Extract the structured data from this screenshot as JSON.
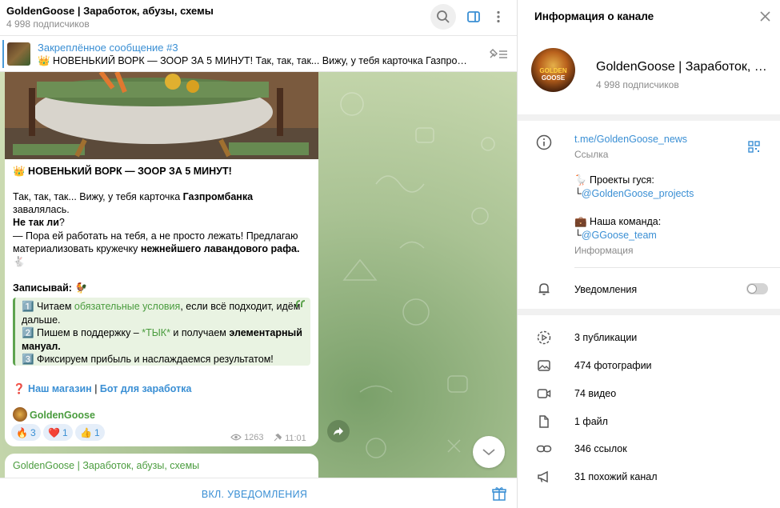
{
  "header": {
    "title": "GoldenGoose | Заработок, абузы, схемы",
    "subscribers": "4 998 подписчиков"
  },
  "pinned": {
    "title": "Закреплённое сообщение #3",
    "text": "👑 НОВЕНЬКИЙ ВОРК — ЗООР ЗА 5 МИНУТ!  Так, так, так... Вижу, у тебя карточка Газпромбан..."
  },
  "message": {
    "heading": "👑 НОВЕНЬКИЙ ВОРК — ЗООР ЗА 5 МИНУТ!",
    "p1_a": "Так, так, так... Вижу, у тебя карточка ",
    "p1_b": "Газпромбанка",
    "p1_c": " завалялась.",
    "p1_d": "Не так ли",
    "p1_e": "?",
    "p2_a": "— Пора ей работать на тебя, а не просто лежать! Предлагаю материализовать кружечку ",
    "p2_b": "нежнейшего лавандового рафа.",
    "p2_c": " 🐇",
    "write": "Записывай:",
    "write_emoji": " 🐓",
    "q1_num": "1️⃣ ",
    "q1_a": "Читаем ",
    "q1_link": "обязательные условия",
    "q1_b": ", если всё подходит, идём дальше.",
    "q2_num": "2️⃣ ",
    "q2_a": "Пишем в поддержку – ",
    "q2_link": "*ТЫК*",
    "q2_b": " и получаем ",
    "q2_c": "элементарный мануал.",
    "q3_num": "3️⃣ ",
    "q3_a": "Фиксируем прибыль и наслаждаемся результатом!",
    "links_emoji": "❓ ",
    "shop": "Наш магазин",
    "divider": " | ",
    "bot": "Бот для заработка",
    "author": "GoldenGoose",
    "reactions": [
      {
        "emoji": "🔥",
        "count": "3"
      },
      {
        "emoji": "❤️",
        "count": "1"
      },
      {
        "emoji": "👍",
        "count": "1"
      }
    ],
    "views": "1263",
    "time": "11:01"
  },
  "next_message": {
    "author": "GoldenGoose | Заработок, абузы, схемы"
  },
  "bottom": {
    "notify_label": "ВКЛ. УВЕДОМЛЕНИЯ"
  },
  "right": {
    "title": "Информация о канале",
    "channel_name": "GoldenGoose | Заработок, а...",
    "subscribers": "4 998 подписчиков",
    "avatar_text_1": "GOLDEN",
    "avatar_text_2": "GOOSE",
    "link": "t.me/GoldenGoose_news",
    "link_label": "Ссылка",
    "projects_title": "🪿 Проекты гуся:",
    "projects_prefix": "└",
    "projects_link": "@GoldenGoose_projects",
    "team_title": "💼 Наша команда:",
    "team_prefix": "└",
    "team_link": "@GGoose_team",
    "info_label": "Информация",
    "notifications": "Уведомления",
    "notifications_on": false,
    "media": [
      {
        "icon": "publications-icon",
        "label": "3 публикации"
      },
      {
        "icon": "photo-icon",
        "label": "474 фотографии"
      },
      {
        "icon": "video-icon",
        "label": "74 видео"
      },
      {
        "icon": "file-icon",
        "label": "1 файл"
      },
      {
        "icon": "link-icon",
        "label": "346 ссылок"
      },
      {
        "icon": "megaphone-icon",
        "label": "31 похожий канал"
      }
    ]
  },
  "colors": {
    "accent": "#3a8fd4",
    "green": "#4a9c3e",
    "chat_bg": "#a9c293"
  }
}
